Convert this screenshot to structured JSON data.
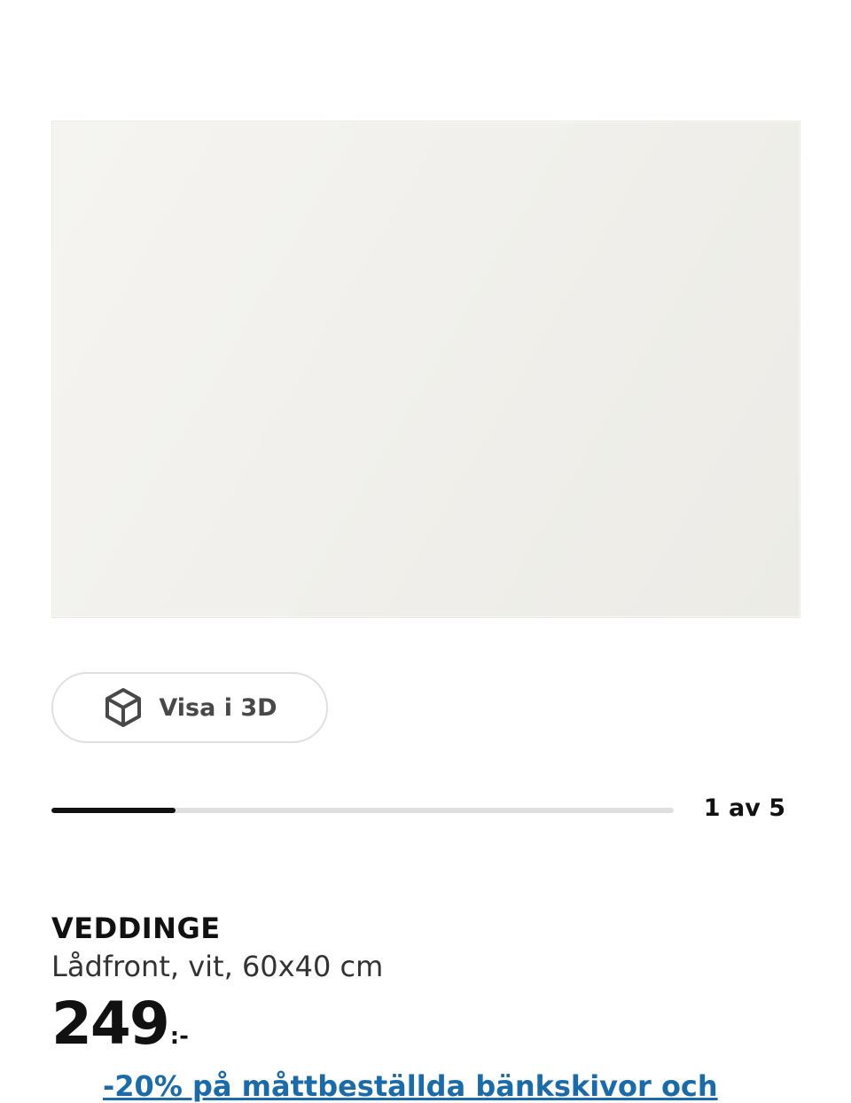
{
  "gallery": {
    "view3d_label": "Visa i 3D",
    "view3d_icon": "cube-icon",
    "counter": "1 av 5",
    "progress_fraction": 0.2
  },
  "product": {
    "name": "VEDDINGE",
    "description": "Lådfront, vit, 60x40 cm",
    "price": "249",
    "price_suffix": ":-"
  },
  "promo": {
    "text": "-20% på måttbeställda bänkskivor och"
  },
  "colors": {
    "text": "#111111",
    "link": "#1a6ba8",
    "track": "#dfdfdf"
  }
}
